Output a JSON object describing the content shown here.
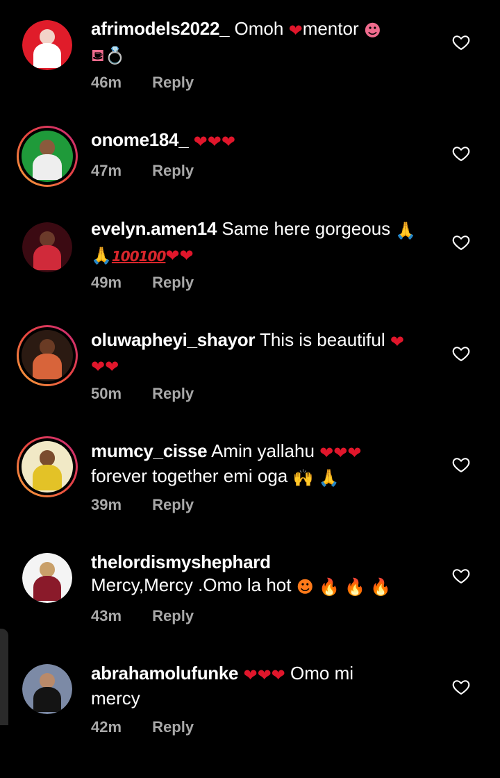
{
  "comments": [
    {
      "username": "afrimodels2022_",
      "text": "Omoh",
      "emojis": [
        "heart-emoji",
        "tongue-emoji",
        "shopping-bag-emoji",
        "ring-emoji"
      ],
      "text2": "mentor",
      "time": "46m",
      "reply": "Reply",
      "avatar_colors": [
        "#e01c2a",
        "#ffffff",
        "#f2d3c9"
      ],
      "has_story_ring": false
    },
    {
      "username": "onome184_",
      "text": "",
      "emojis": [
        "heart-emoji",
        "heart-emoji",
        "heart-emoji"
      ],
      "time": "47m",
      "reply": "Reply",
      "avatar_colors": [
        "#1f9a3a",
        "#eeeeee",
        "#8a5a3c"
      ],
      "has_story_ring": true
    },
    {
      "username": "evelyn.amen14",
      "text": "Same here gorgeous",
      "emojis": [
        "pray-emoji",
        "pray-emoji",
        "hundred-emoji",
        "hundred-emoji",
        "heart-emoji",
        "heart-emoji"
      ],
      "time": "49m",
      "reply": "Reply",
      "avatar_colors": [
        "#3b0a12",
        "#d02a3a",
        "#6b3a2a"
      ],
      "has_story_ring": false
    },
    {
      "username": "oluwapheyi_shayor",
      "text": "This is beautiful",
      "emojis": [
        "heart-emoji",
        "heart-emoji",
        "heart-emoji"
      ],
      "time": "50m",
      "reply": "Reply",
      "avatar_colors": [
        "#2b1a12",
        "#d8643a",
        "#6a3b24"
      ],
      "has_story_ring": true
    },
    {
      "username": "mumcy_cisse",
      "text": "Amin yallahu",
      "text2": "forever together emi oga",
      "emojis": [
        "heart-emoji",
        "heart-emoji",
        "heart-emoji",
        "raised-hands-emoji",
        "pray-emoji"
      ],
      "time": "39m",
      "reply": "Reply",
      "avatar_colors": [
        "#f1e9c6",
        "#e3c227",
        "#7a4c2e"
      ],
      "has_story_ring": true
    },
    {
      "username": "thelordismyshephard",
      "text": "Mercy,Mercy .Omo la hot",
      "emojis": [
        "hot-face-emoji",
        "fire-emoji",
        "fire-emoji",
        "fire-emoji"
      ],
      "time": "43m",
      "reply": "Reply",
      "avatar_colors": [
        "#f4f4f4",
        "#8a1a2a",
        "#c9a06a"
      ],
      "has_story_ring": false
    },
    {
      "username": "abrahamolufunke",
      "text": "Omo mi",
      "text2": "mercy",
      "emojis": [
        "heart-emoji",
        "heart-emoji",
        "heart-emoji"
      ],
      "time": "42m",
      "reply": "Reply",
      "avatar_colors": [
        "#7c8aa6",
        "#141414",
        "#b98a6a"
      ],
      "has_story_ring": false
    }
  ],
  "colors": {
    "background": "#000000",
    "meta_text": "#a8a8a8",
    "heart_red": "#e0162b",
    "story_ring_start": "#f9a93b",
    "story_ring_end": "#c8287a"
  }
}
